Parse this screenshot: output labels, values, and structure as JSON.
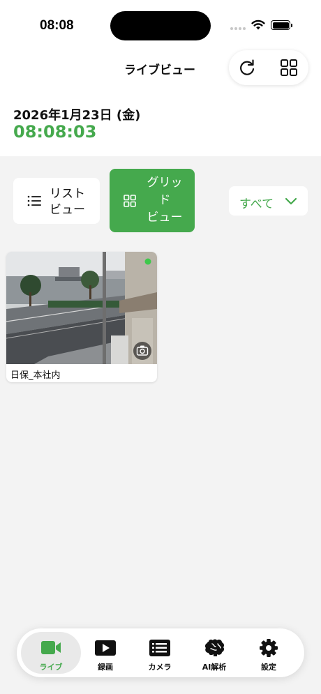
{
  "status_bar": {
    "time": "08:08"
  },
  "header": {
    "title": "ライブビュー"
  },
  "top_actions": {
    "refresh_icon": "refresh-icon",
    "grid_icon": "grid-icon"
  },
  "datetime": {
    "date": "2026年1月23日 (金)",
    "time": "08:08:03"
  },
  "view_toggle": {
    "list_label": "リスト\nビュー",
    "grid_label": "グリッ\nド\nビュー",
    "selected": "grid"
  },
  "filter": {
    "label": "すべて"
  },
  "cameras": [
    {
      "name": "日保_本社内",
      "status": "online"
    }
  ],
  "tabs": [
    {
      "label": "ライブ",
      "icon": "video-camera-icon",
      "active": true
    },
    {
      "label": "録画",
      "icon": "play-icon",
      "active": false
    },
    {
      "label": "カメラ",
      "icon": "camera-list-icon",
      "active": false
    },
    {
      "label": "AI解析",
      "icon": "brain-icon",
      "active": false
    },
    {
      "label": "設定",
      "icon": "gear-icon",
      "active": false
    }
  ],
  "colors": {
    "accent": "#45a94d",
    "online": "#3ec84b",
    "background": "#f3f3f3"
  }
}
